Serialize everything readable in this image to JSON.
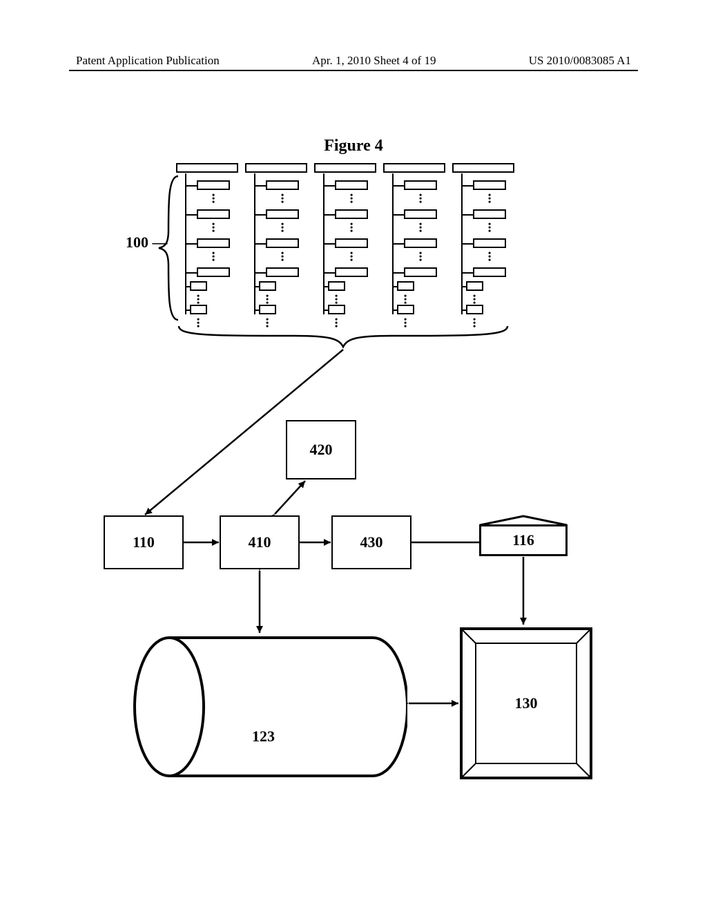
{
  "header": {
    "left": "Patent Application Publication",
    "mid": "Apr. 1, 2010  Sheet 4 of 19",
    "right": "US 2010/0083085 A1"
  },
  "figure": {
    "title": "Figure 4"
  },
  "labels": {
    "ref100": "100",
    "ref110": "110",
    "ref116": "116",
    "ref123": "123",
    "ref130": "130",
    "ref410": "410",
    "ref420": "420",
    "ref430": "430"
  }
}
